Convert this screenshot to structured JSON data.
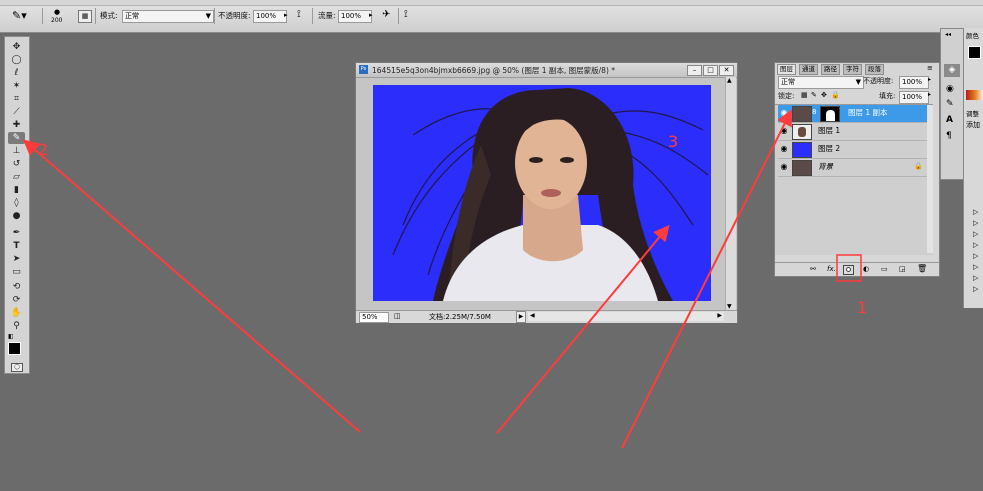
{
  "options_bar": {
    "brush_size": "200",
    "mode_label": "模式:",
    "mode_value": "正常",
    "opacity_label": "不透明度:",
    "opacity_value": "100%",
    "flow_label": "流量:",
    "flow_value": "100%"
  },
  "document": {
    "title": "164515e5q3on4bjmxb6669.jpg @ 50% (图层 1 副本, 图层蒙版/8) *",
    "zoom": "50%",
    "doc_info": "文档:2.25M/7.50M",
    "ps_badge": "Ps"
  },
  "layers_panel": {
    "tabs": [
      "图层",
      "通道",
      "路径",
      "字符",
      "段落"
    ],
    "blend_mode": "正常",
    "opacity_label": "不透明度:",
    "opacity_value": "100%",
    "lock_label": "锁定:",
    "fill_label": "填充:",
    "fill_value": "100%",
    "layers": [
      {
        "name": "图层 1 副本",
        "selected": true
      },
      {
        "name": "图层 1",
        "selected": false
      },
      {
        "name": "图层 2",
        "selected": false
      },
      {
        "name": "背景",
        "selected": false
      }
    ],
    "bottom_fx": "fx."
  },
  "right_panel": {
    "label_top": "颜色",
    "label_adj": "调整",
    "label_add": "添加"
  },
  "annotations": {
    "n1": "1",
    "n2": "2",
    "n3": "3",
    "color": "#ff3b3b"
  },
  "colors": {
    "workspace": "#6b6b6b",
    "canvas_blue": "#2b2dfb",
    "layer_selected": "#3d9ae8"
  }
}
